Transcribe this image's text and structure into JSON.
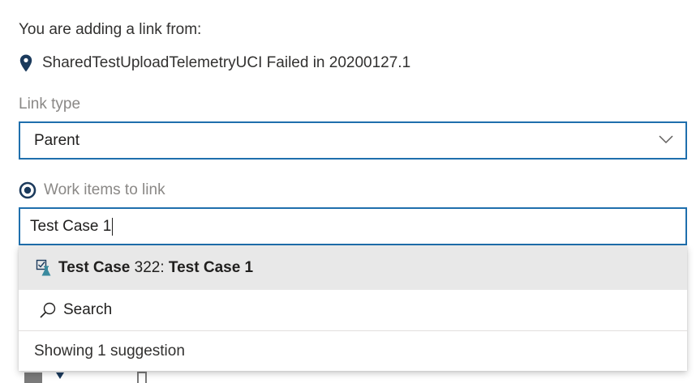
{
  "dialog": {
    "heading": "You are adding a link from:",
    "source": {
      "icon": "location-pin-icon",
      "text": "SharedTestUploadTelemetryUCI Failed in 20200127.1"
    },
    "link_type": {
      "label": "Link type",
      "selected": "Parent",
      "chevron_icon": "chevron-down-icon"
    },
    "work_items": {
      "label": "Work items to link",
      "radio_icon": "radio-selected-icon",
      "search_value": "Test Case 1"
    },
    "suggestions": {
      "items": [
        {
          "icon": "test-case-icon",
          "type": "Test Case",
          "id": "322:",
          "title": "Test Case 1"
        }
      ],
      "search_action": {
        "icon": "search-icon",
        "label": "Search"
      },
      "footer": "Showing 1 suggestion"
    }
  },
  "colors": {
    "focus_border": "#1f6fad",
    "icon_navy": "#1b3a5c",
    "test_case_teal": "#3a8a9e",
    "highlight_row": "#e8e8e8",
    "muted_text": "#8a8886"
  }
}
